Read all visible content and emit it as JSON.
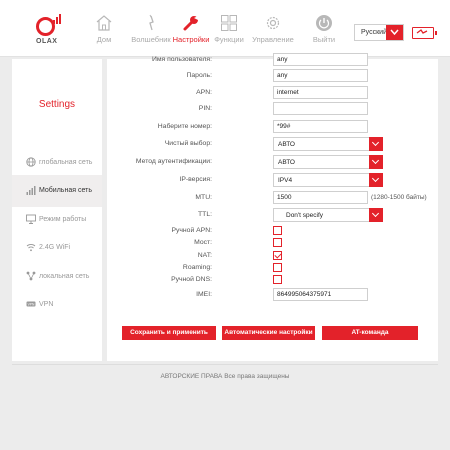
{
  "header": {
    "logo_text": "OLAX",
    "nav": [
      {
        "label": "Дом",
        "icon": "home-icon"
      },
      {
        "label": "Волшебник",
        "icon": "magic-wand-icon"
      },
      {
        "label": "Настройки",
        "icon": "wrench-icon",
        "active": true
      },
      {
        "label": "Функции",
        "icon": "grid-icon"
      },
      {
        "label": "Управление",
        "icon": "gear-icon"
      },
      {
        "label": "Выйти",
        "icon": "logout-icon"
      }
    ],
    "language": "Русский",
    "accent_color": "#e3222a"
  },
  "sidebar": {
    "title": "Settings",
    "items": [
      {
        "label": "глобальная сеть",
        "icon": "globe-icon"
      },
      {
        "label": "Мобильная сеть",
        "icon": "signal-icon",
        "active": true
      },
      {
        "label": "Режим работы",
        "icon": "monitor-icon"
      },
      {
        "label": "2.4G WiFi",
        "icon": "wifi-icon"
      },
      {
        "label": "локальная сеть",
        "icon": "network-icon"
      },
      {
        "label": "VPN",
        "icon": "vpn-icon"
      }
    ]
  },
  "form": {
    "username": {
      "label": "Имя пользователя:",
      "value": "any"
    },
    "password": {
      "label": "Пароль:",
      "value": "any"
    },
    "apn": {
      "label": "APN:",
      "value": "internet"
    },
    "pin": {
      "label": "PIN:",
      "value": ""
    },
    "dial_number": {
      "label": "Наберите номер:",
      "value": "*99#"
    },
    "clean_select": {
      "label": "Чистый выбор:",
      "value": "АВТО"
    },
    "auth_method": {
      "label": "Метод аутентификации:",
      "value": "АВТО"
    },
    "ip_version": {
      "label": "IP-версия:",
      "value": "IPV4"
    },
    "mtu": {
      "label": "MTU:",
      "value": "1500",
      "hint": "(1280-1500 байты)"
    },
    "ttl": {
      "label": "TTL:",
      "value": "Don't specify"
    },
    "manual_apn": {
      "label": "Ручной APN:",
      "checked": false
    },
    "bridge": {
      "label": "Мост:",
      "checked": false
    },
    "nat": {
      "label": "NAT:",
      "checked": true
    },
    "roaming": {
      "label": "Roaming:",
      "checked": false
    },
    "manual_dns": {
      "label": "Ручной DNS:",
      "checked": false
    },
    "imei": {
      "label": "IMEI:",
      "value": "864995064375971"
    }
  },
  "buttons": {
    "save": "Сохранить и применить",
    "auto": "Автоматические настройки",
    "at": "AT-команда"
  },
  "footer": {
    "copyright": "АВТОРСКИЕ ПРАВА Все права защищены"
  }
}
